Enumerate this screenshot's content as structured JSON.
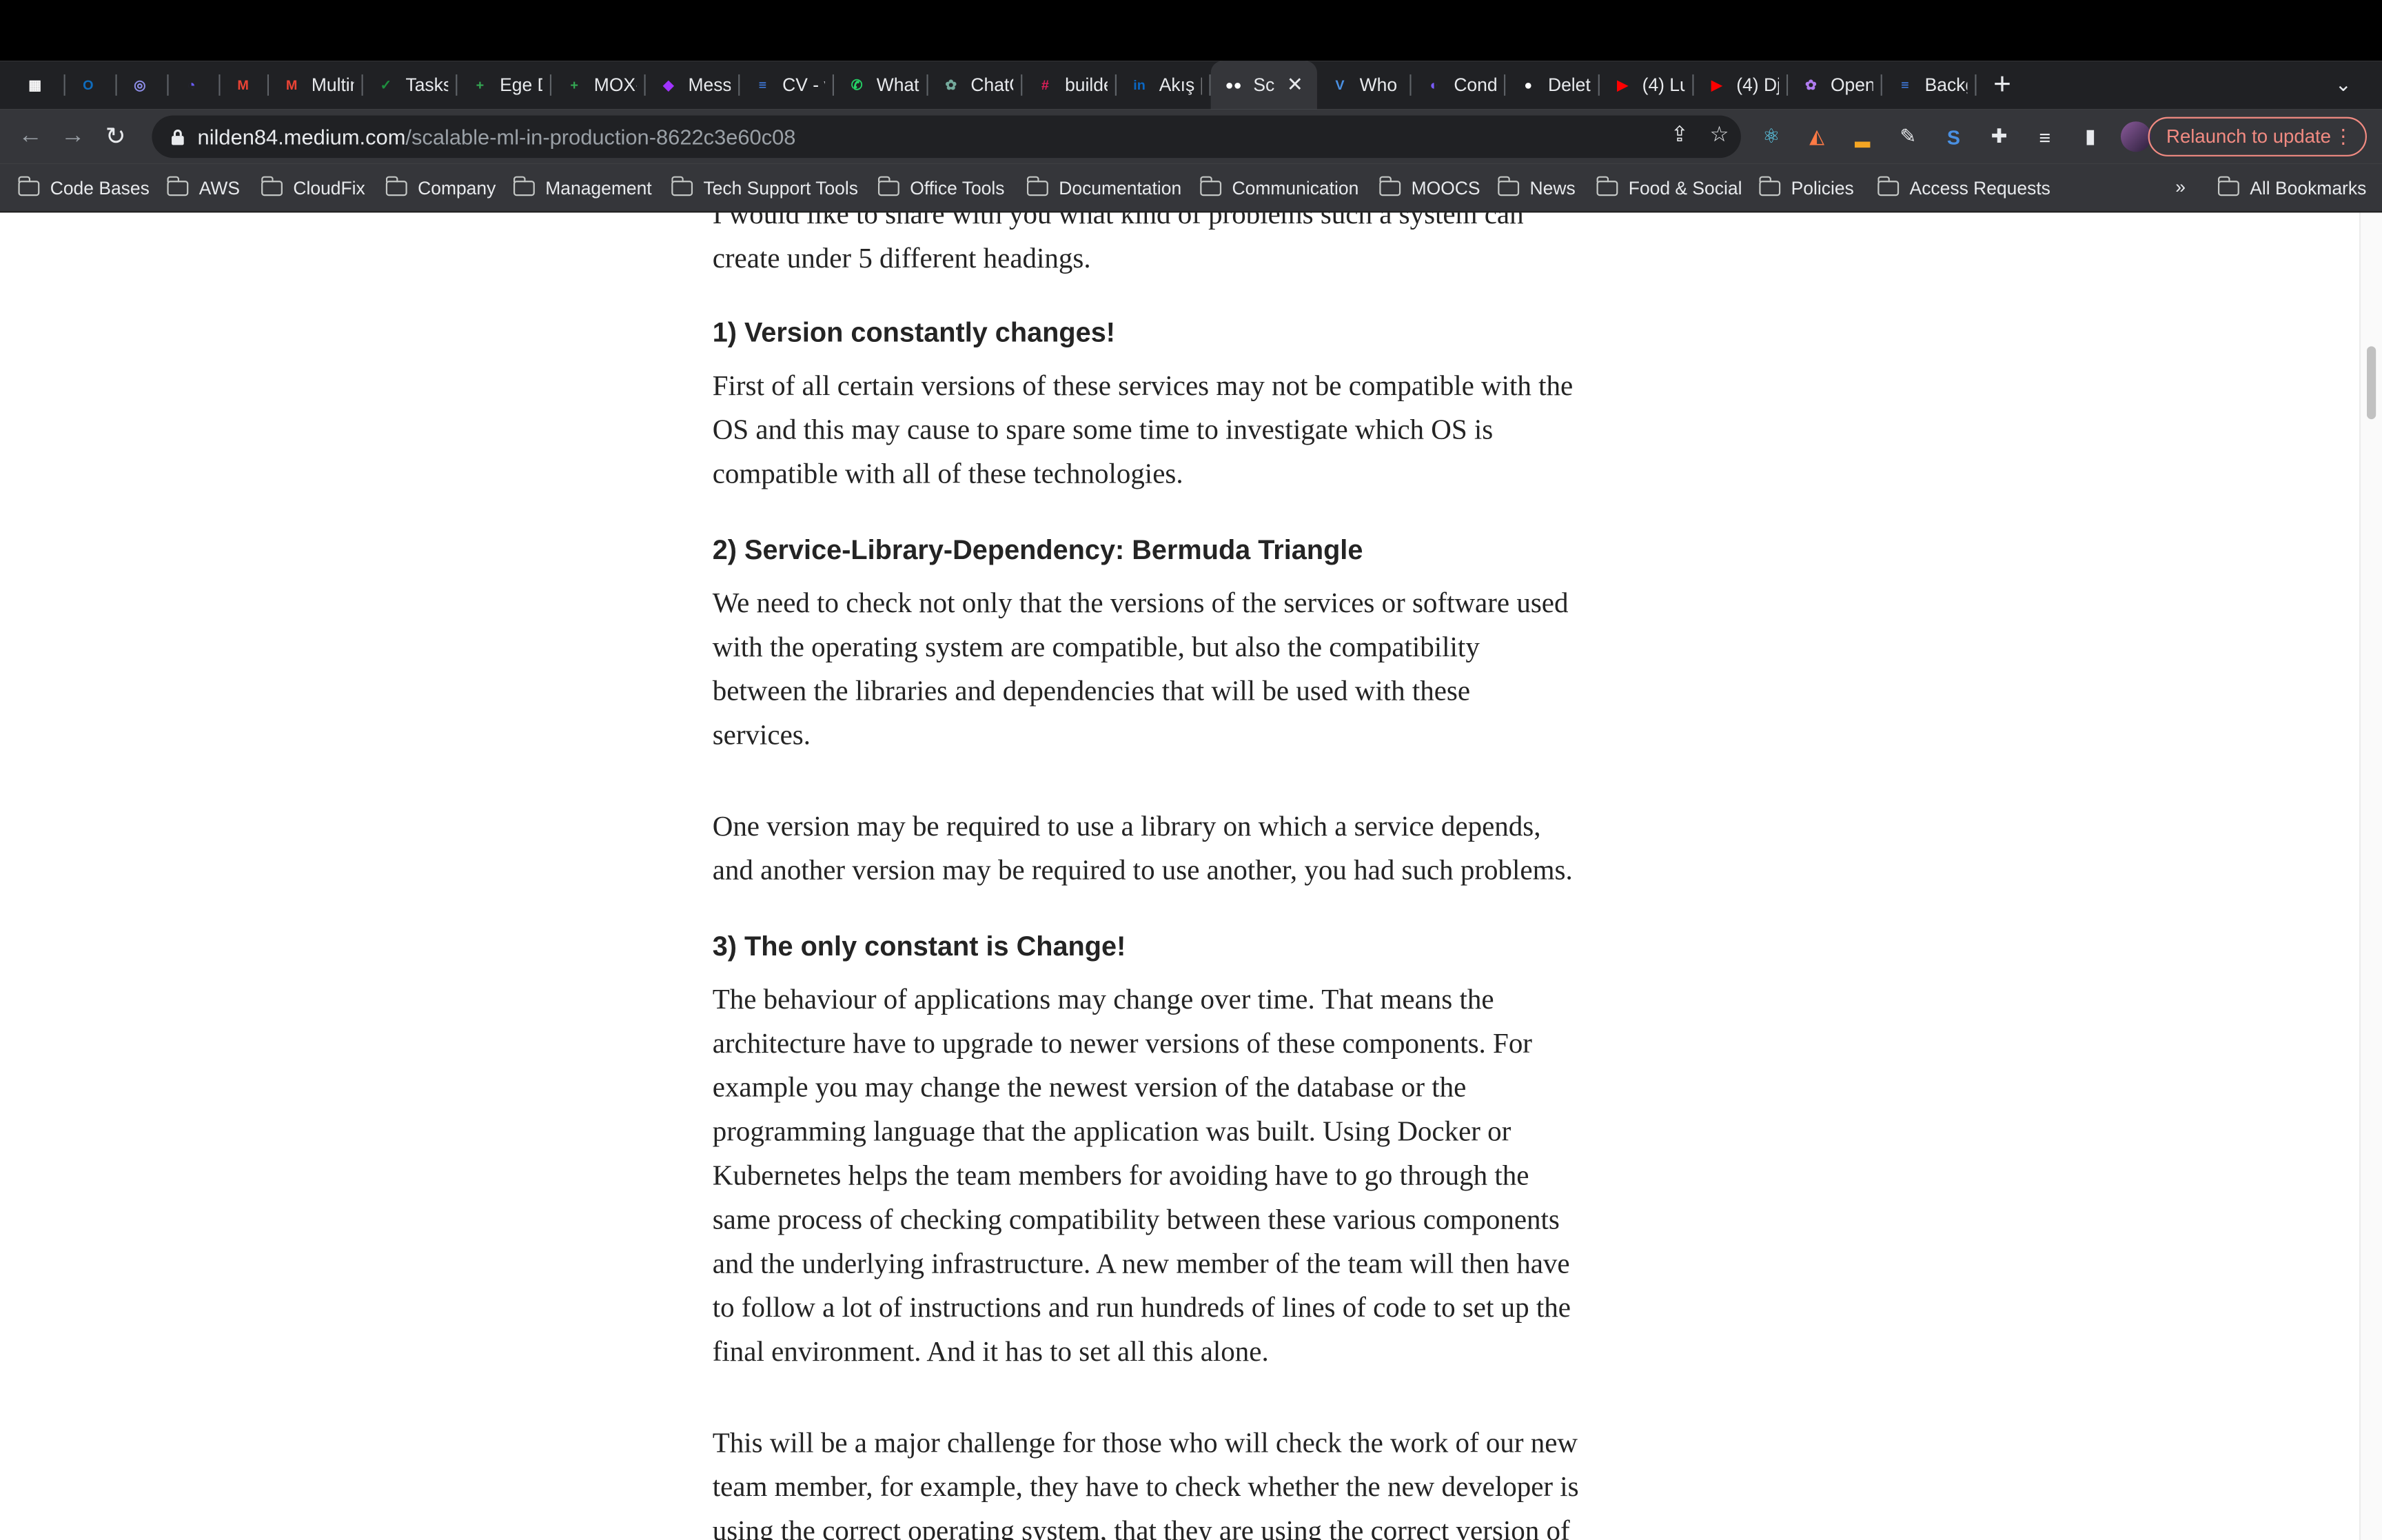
{
  "tabs": [
    {
      "title": "",
      "icon": "apps-icon",
      "color": "#ffffff"
    },
    {
      "title": "",
      "icon": "outlook-icon",
      "color": "#0f6cbd"
    },
    {
      "title": "",
      "icon": "circle-app-icon",
      "color": "#8e8ee8"
    },
    {
      "title": "",
      "icon": "clockify-icon",
      "color": "#6a5cff"
    },
    {
      "title": "",
      "icon": "gmail-icon",
      "color": "#ea4335"
    },
    {
      "title": "Multin",
      "icon": "gmail-icon",
      "color": "#ea4335"
    },
    {
      "title": "Tasks",
      "icon": "tasks-icon",
      "color": "#1e8e3e"
    },
    {
      "title": "Ege D",
      "icon": "sheets-icon",
      "color": "#34a853"
    },
    {
      "title": "MOX-F",
      "icon": "sheets-icon",
      "color": "#34a853"
    },
    {
      "title": "Messe",
      "icon": "messenger-icon",
      "color": "#a033ff"
    },
    {
      "title": "CV - v",
      "icon": "docs-icon",
      "color": "#4285f4"
    },
    {
      "title": "Whats",
      "icon": "whatsapp-icon",
      "color": "#25d366"
    },
    {
      "title": "ChatG",
      "icon": "chatgpt-icon",
      "color": "#74aa9c"
    },
    {
      "title": "builde",
      "icon": "slack-icon",
      "color": "#e01e5a"
    },
    {
      "title": "Akış |",
      "icon": "linkedin-icon",
      "color": "#0a66c2"
    },
    {
      "title": "Sc",
      "icon": "medium-icon",
      "color": "#ffffff",
      "active": true
    },
    {
      "title": "Who D",
      "icon": "vercel-icon",
      "color": "#4a90e2"
    },
    {
      "title": "Condi",
      "icon": "condition-icon",
      "color": "#7a5cff"
    },
    {
      "title": "Delete",
      "icon": "github-icon",
      "color": "#ffffff"
    },
    {
      "title": "(4) Lu",
      "icon": "youtube-icon",
      "color": "#ff0000"
    },
    {
      "title": "(4) Dj",
      "icon": "youtube-icon",
      "color": "#ff0000"
    },
    {
      "title": "OpenA",
      "icon": "openai-icon",
      "color": "#b07cf0"
    },
    {
      "title": "Backg",
      "icon": "docs-icon",
      "color": "#4285f4"
    }
  ],
  "address": {
    "host": "nilden84.medium.com",
    "path": "/scalable-ml-in-production-8622c3e60c08"
  },
  "relaunch_label": "Relaunch to update",
  "bookmarks": [
    "Code Bases",
    "AWS",
    "CloudFix",
    "Company",
    "Management",
    "Tech Support Tools",
    "Office Tools",
    "Documentation",
    "Communication",
    "MOOCS",
    "News",
    "Food & Social",
    "Policies",
    "Access Requests"
  ],
  "all_bookmarks_label": "All Bookmarks",
  "article": {
    "intro": [
      "I would like to share with you what kind of problems such a system can",
      "create under 5 different headings."
    ],
    "h1": "1) Version constantly changes!",
    "p1": [
      "First of all certain versions of these services may not be compatible with the",
      "OS and this may cause to spare some time to investigate which OS is",
      "compatible with all of these technologies."
    ],
    "h2": "2) Service-Library-Dependency: Bermuda Triangle",
    "p2": [
      "We need to check not only that the versions of the services or software used",
      "with the operating system are compatible, but also the compatibility",
      "between the libraries and dependencies that will be used with these",
      "services."
    ],
    "p3": [
      "One version may be required to use a library on which a service depends,",
      "and another version may be required to use another, you had such problems."
    ],
    "h3": "3) The only constant is Change!",
    "p4": [
      "The behaviour of applications may change over time. That means the",
      "architecture have to upgrade to newer versions of these components. For",
      "example you may change the newest version of the database or the",
      "programming language that the application was built. Using Docker or",
      "Kubernetes helps the team members for avoiding have to go through the",
      "same process of checking compatibility between these various components",
      "and the underlying infrastructure. A new member of the team will then have",
      "to follow a lot of instructions and run hundreds of lines of code to set up the",
      "final environment. And it has to set all this alone."
    ],
    "p5": [
      "This will be a major challenge for those who will check the work of our new",
      "team member, for example, they have to check whether the new developer is",
      "using the correct operating system, that they are using the correct version of"
    ]
  }
}
